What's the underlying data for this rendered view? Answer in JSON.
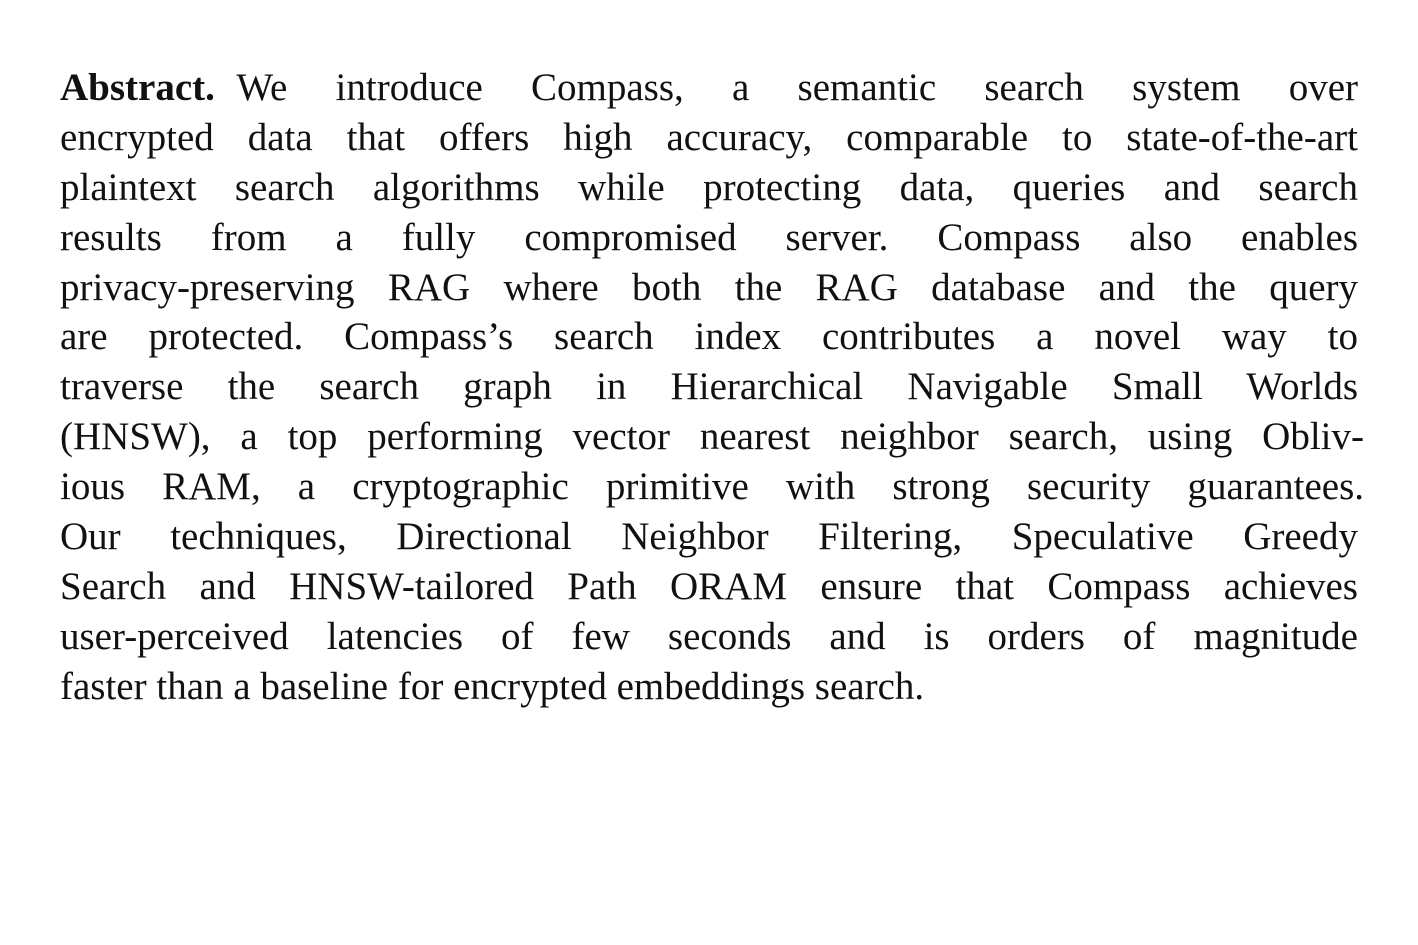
{
  "abstract": {
    "lead": "Abstract.",
    "lines": [
      "We introduce Compass, a semantic search system over",
      "encrypted data that offers high accuracy, comparable to state-of-the-art",
      "plaintext search algorithms while protecting data, queries and search",
      "results from a fully compromised server.  Compass also enables",
      "privacy-preserving RAG where both the RAG database and the query",
      "are protected.  Compass’s search index contributes a novel way to",
      "traverse the search graph in Hierarchical Navigable Small Worlds",
      "(HNSW), a top performing vector nearest neighbor search, using Obliv-",
      "ious RAM, a cryptographic primitive with strong security guarantees.",
      "Our techniques, Directional Neighbor Filtering, Speculative Greedy",
      "Search and HNSW-tailored Path ORAM ensure that Compass achieves",
      "user-perceived latencies of few seconds and is orders of magnitude",
      "faster than a baseline for encrypted embeddings search."
    ]
  }
}
